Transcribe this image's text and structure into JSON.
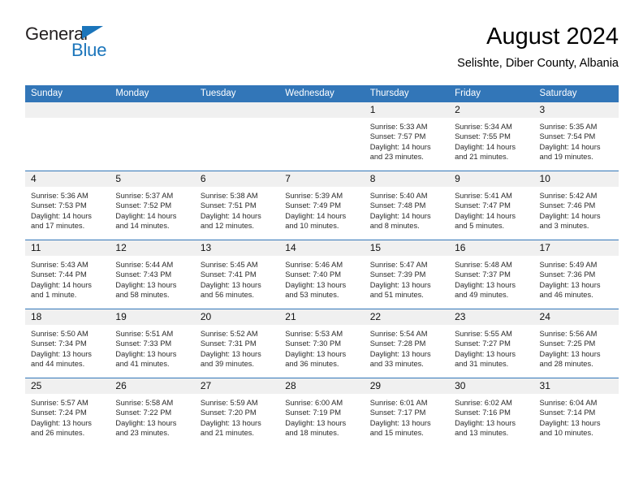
{
  "brand": {
    "name_top": "General",
    "name_bottom": "Blue",
    "accent_color": "#1b75bb",
    "triangle_icon": "brand-triangle-icon"
  },
  "header": {
    "month_title": "August 2024",
    "location": "Selishte, Diber County, Albania"
  },
  "theme": {
    "header_blue": "#3276b8",
    "daynum_band": "#f0f0f0",
    "text": "#2a2a2a"
  },
  "calendar": {
    "weekday_headers": [
      "Sunday",
      "Monday",
      "Tuesday",
      "Wednesday",
      "Thursday",
      "Friday",
      "Saturday"
    ],
    "weeks": [
      [
        {
          "day": "",
          "lines": []
        },
        {
          "day": "",
          "lines": []
        },
        {
          "day": "",
          "lines": []
        },
        {
          "day": "",
          "lines": []
        },
        {
          "day": "1",
          "lines": [
            "Sunrise: 5:33 AM",
            "Sunset: 7:57 PM",
            "Daylight: 14 hours",
            "and 23 minutes."
          ]
        },
        {
          "day": "2",
          "lines": [
            "Sunrise: 5:34 AM",
            "Sunset: 7:55 PM",
            "Daylight: 14 hours",
            "and 21 minutes."
          ]
        },
        {
          "day": "3",
          "lines": [
            "Sunrise: 5:35 AM",
            "Sunset: 7:54 PM",
            "Daylight: 14 hours",
            "and 19 minutes."
          ]
        }
      ],
      [
        {
          "day": "4",
          "lines": [
            "Sunrise: 5:36 AM",
            "Sunset: 7:53 PM",
            "Daylight: 14 hours",
            "and 17 minutes."
          ]
        },
        {
          "day": "5",
          "lines": [
            "Sunrise: 5:37 AM",
            "Sunset: 7:52 PM",
            "Daylight: 14 hours",
            "and 14 minutes."
          ]
        },
        {
          "day": "6",
          "lines": [
            "Sunrise: 5:38 AM",
            "Sunset: 7:51 PM",
            "Daylight: 14 hours",
            "and 12 minutes."
          ]
        },
        {
          "day": "7",
          "lines": [
            "Sunrise: 5:39 AM",
            "Sunset: 7:49 PM",
            "Daylight: 14 hours",
            "and 10 minutes."
          ]
        },
        {
          "day": "8",
          "lines": [
            "Sunrise: 5:40 AM",
            "Sunset: 7:48 PM",
            "Daylight: 14 hours",
            "and 8 minutes."
          ]
        },
        {
          "day": "9",
          "lines": [
            "Sunrise: 5:41 AM",
            "Sunset: 7:47 PM",
            "Daylight: 14 hours",
            "and 5 minutes."
          ]
        },
        {
          "day": "10",
          "lines": [
            "Sunrise: 5:42 AM",
            "Sunset: 7:46 PM",
            "Daylight: 14 hours",
            "and 3 minutes."
          ]
        }
      ],
      [
        {
          "day": "11",
          "lines": [
            "Sunrise: 5:43 AM",
            "Sunset: 7:44 PM",
            "Daylight: 14 hours",
            "and 1 minute."
          ]
        },
        {
          "day": "12",
          "lines": [
            "Sunrise: 5:44 AM",
            "Sunset: 7:43 PM",
            "Daylight: 13 hours",
            "and 58 minutes."
          ]
        },
        {
          "day": "13",
          "lines": [
            "Sunrise: 5:45 AM",
            "Sunset: 7:41 PM",
            "Daylight: 13 hours",
            "and 56 minutes."
          ]
        },
        {
          "day": "14",
          "lines": [
            "Sunrise: 5:46 AM",
            "Sunset: 7:40 PM",
            "Daylight: 13 hours",
            "and 53 minutes."
          ]
        },
        {
          "day": "15",
          "lines": [
            "Sunrise: 5:47 AM",
            "Sunset: 7:39 PM",
            "Daylight: 13 hours",
            "and 51 minutes."
          ]
        },
        {
          "day": "16",
          "lines": [
            "Sunrise: 5:48 AM",
            "Sunset: 7:37 PM",
            "Daylight: 13 hours",
            "and 49 minutes."
          ]
        },
        {
          "day": "17",
          "lines": [
            "Sunrise: 5:49 AM",
            "Sunset: 7:36 PM",
            "Daylight: 13 hours",
            "and 46 minutes."
          ]
        }
      ],
      [
        {
          "day": "18",
          "lines": [
            "Sunrise: 5:50 AM",
            "Sunset: 7:34 PM",
            "Daylight: 13 hours",
            "and 44 minutes."
          ]
        },
        {
          "day": "19",
          "lines": [
            "Sunrise: 5:51 AM",
            "Sunset: 7:33 PM",
            "Daylight: 13 hours",
            "and 41 minutes."
          ]
        },
        {
          "day": "20",
          "lines": [
            "Sunrise: 5:52 AM",
            "Sunset: 7:31 PM",
            "Daylight: 13 hours",
            "and 39 minutes."
          ]
        },
        {
          "day": "21",
          "lines": [
            "Sunrise: 5:53 AM",
            "Sunset: 7:30 PM",
            "Daylight: 13 hours",
            "and 36 minutes."
          ]
        },
        {
          "day": "22",
          "lines": [
            "Sunrise: 5:54 AM",
            "Sunset: 7:28 PM",
            "Daylight: 13 hours",
            "and 33 minutes."
          ]
        },
        {
          "day": "23",
          "lines": [
            "Sunrise: 5:55 AM",
            "Sunset: 7:27 PM",
            "Daylight: 13 hours",
            "and 31 minutes."
          ]
        },
        {
          "day": "24",
          "lines": [
            "Sunrise: 5:56 AM",
            "Sunset: 7:25 PM",
            "Daylight: 13 hours",
            "and 28 minutes."
          ]
        }
      ],
      [
        {
          "day": "25",
          "lines": [
            "Sunrise: 5:57 AM",
            "Sunset: 7:24 PM",
            "Daylight: 13 hours",
            "and 26 minutes."
          ]
        },
        {
          "day": "26",
          "lines": [
            "Sunrise: 5:58 AM",
            "Sunset: 7:22 PM",
            "Daylight: 13 hours",
            "and 23 minutes."
          ]
        },
        {
          "day": "27",
          "lines": [
            "Sunrise: 5:59 AM",
            "Sunset: 7:20 PM",
            "Daylight: 13 hours",
            "and 21 minutes."
          ]
        },
        {
          "day": "28",
          "lines": [
            "Sunrise: 6:00 AM",
            "Sunset: 7:19 PM",
            "Daylight: 13 hours",
            "and 18 minutes."
          ]
        },
        {
          "day": "29",
          "lines": [
            "Sunrise: 6:01 AM",
            "Sunset: 7:17 PM",
            "Daylight: 13 hours",
            "and 15 minutes."
          ]
        },
        {
          "day": "30",
          "lines": [
            "Sunrise: 6:02 AM",
            "Sunset: 7:16 PM",
            "Daylight: 13 hours",
            "and 13 minutes."
          ]
        },
        {
          "day": "31",
          "lines": [
            "Sunrise: 6:04 AM",
            "Sunset: 7:14 PM",
            "Daylight: 13 hours",
            "and 10 minutes."
          ]
        }
      ]
    ]
  }
}
